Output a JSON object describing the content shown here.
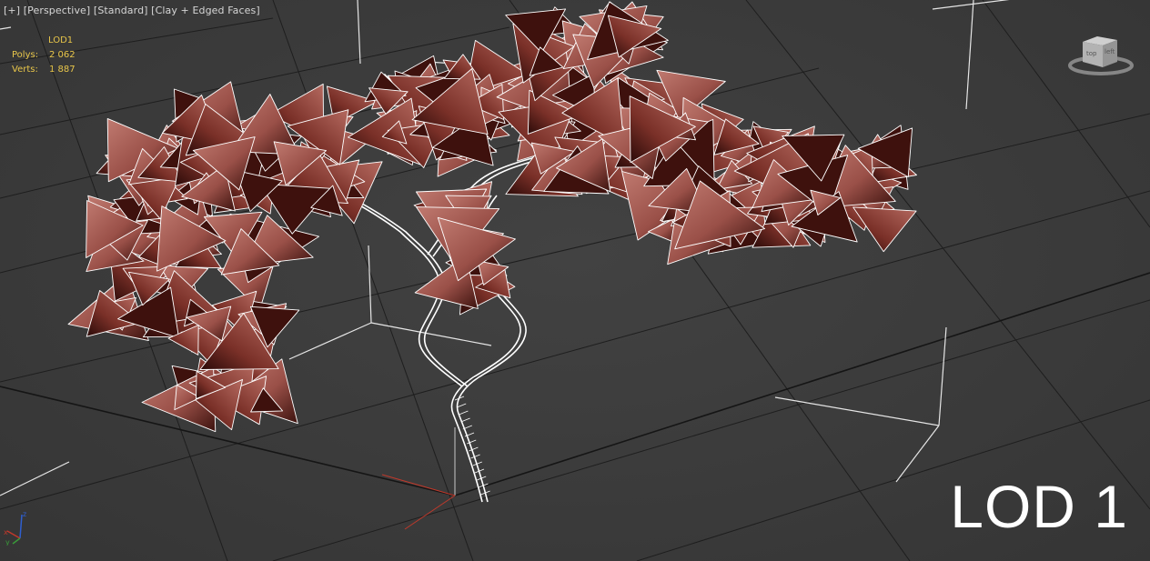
{
  "viewport": {
    "label_plus": "[+]",
    "label_view": "[Perspective]",
    "label_shading": "[Standard]",
    "label_display": "[Clay + Edged Faces]"
  },
  "stats": {
    "title": "LOD1",
    "polys_label": "Polys:",
    "polys_value": "2 062",
    "verts_label": "Verts:",
    "verts_value": "1 887"
  },
  "watermark": "LOD 1",
  "viewcube": {
    "face_label": "top",
    "face_label_2": "left"
  },
  "colors": {
    "background": "#3b3b3b",
    "stats_text": "#e8c64a",
    "leaf_fill": "#a86058",
    "leaf_dark": "#4a1814",
    "edge": "#ffffff",
    "x_axis": "#c0392b",
    "y_axis": "#2f5fd0",
    "z_axis": "#3a9a3a"
  },
  "axes": {
    "x": "x",
    "y": "y",
    "z": "z"
  }
}
